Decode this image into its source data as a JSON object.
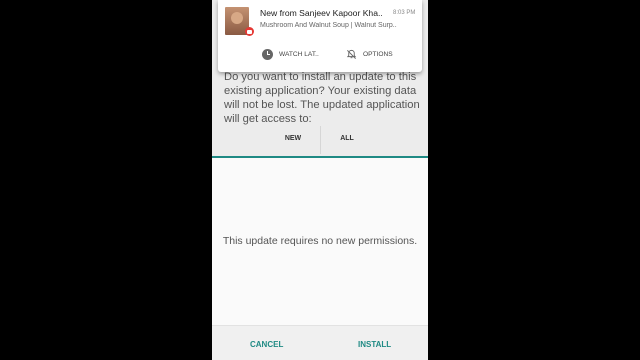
{
  "notification": {
    "title": "New from Sanjeev Kapoor Kha..",
    "time": "8:03 PM",
    "text": "Mushroom And Walnut Soup | Walnut Surp..",
    "actions": [
      {
        "label": "WATCH LAT..",
        "icon": "clock-icon"
      },
      {
        "label": "OPTIONS",
        "icon": "bell-off-icon"
      }
    ]
  },
  "installer": {
    "prompt": "Do you want to install an update to this existing application? Your existing data will not be lost. The updated application will get access to:",
    "tabs": [
      {
        "label": "NEW"
      },
      {
        "label": "ALL"
      }
    ],
    "permissions_message": "This update requires no new permissions.",
    "buttons": {
      "cancel": "CANCEL",
      "install": "INSTALL"
    },
    "accent_color": "#1f8a84"
  }
}
